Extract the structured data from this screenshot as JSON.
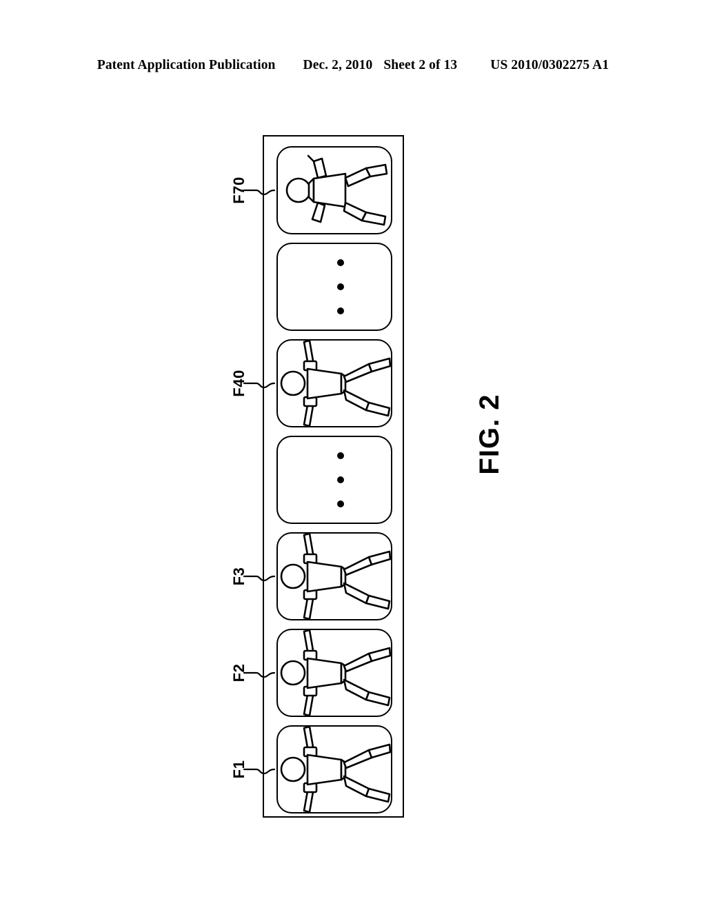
{
  "header": {
    "publication": "Patent Application Publication",
    "date": "Dec. 2, 2010",
    "sheet": "Sheet 2 of 13",
    "doc_number": "US 2010/0302275 A1"
  },
  "figure": {
    "caption": "FIG. 2",
    "frames": [
      {
        "id": "f70",
        "label": "F70",
        "kind": "pose-arms-bent"
      },
      {
        "id": "ellipsis-upper",
        "label": "",
        "kind": "ellipsis"
      },
      {
        "id": "f40",
        "label": "F40",
        "kind": "pose-standing"
      },
      {
        "id": "ellipsis-lower",
        "label": "",
        "kind": "ellipsis"
      },
      {
        "id": "f3",
        "label": "F3",
        "kind": "pose-standing"
      },
      {
        "id": "f2",
        "label": "F2",
        "kind": "pose-standing"
      },
      {
        "id": "f1",
        "label": "F1",
        "kind": "pose-standing"
      }
    ],
    "ellipsis_dot_count": 3,
    "stroke_color": "#000000",
    "background_color": "#ffffff"
  }
}
